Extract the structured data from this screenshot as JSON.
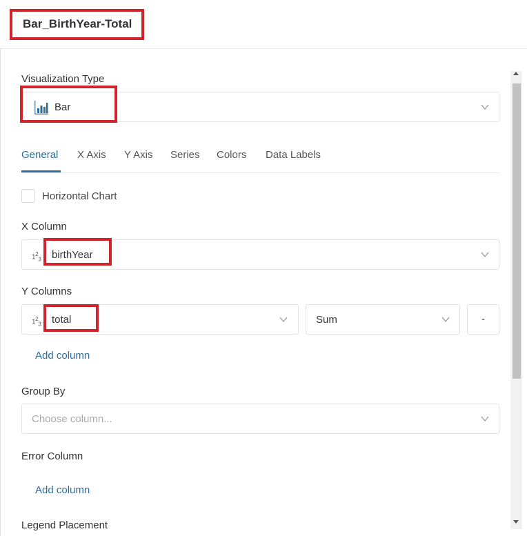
{
  "header": {
    "title": "Bar_BirthYear-Total"
  },
  "visualization_type": {
    "label": "Visualization Type",
    "value": "Bar",
    "icon": "bar-chart-icon"
  },
  "tabs": [
    {
      "label": "General",
      "active": true
    },
    {
      "label": "X Axis",
      "active": false
    },
    {
      "label": "Y Axis",
      "active": false
    },
    {
      "label": "Series",
      "active": false
    },
    {
      "label": "Colors",
      "active": false
    },
    {
      "label": "Data Labels",
      "active": false
    }
  ],
  "horizontal_chart": {
    "label": "Horizontal Chart",
    "checked": false
  },
  "x_column": {
    "label": "X Column",
    "value": "birthYear",
    "type_icon": "numeric-type-icon"
  },
  "y_columns": {
    "label": "Y Columns",
    "value": "total",
    "aggregation": "Sum",
    "remove_label": "-",
    "add_label": "Add column"
  },
  "group_by": {
    "label": "Group By",
    "placeholder": "Choose column..."
  },
  "error_column": {
    "label": "Error Column",
    "add_label": "Add column"
  },
  "legend_placement": {
    "label": "Legend Placement"
  },
  "colors": {
    "accent": "#2c6e9e",
    "highlight": "#d2232a"
  }
}
